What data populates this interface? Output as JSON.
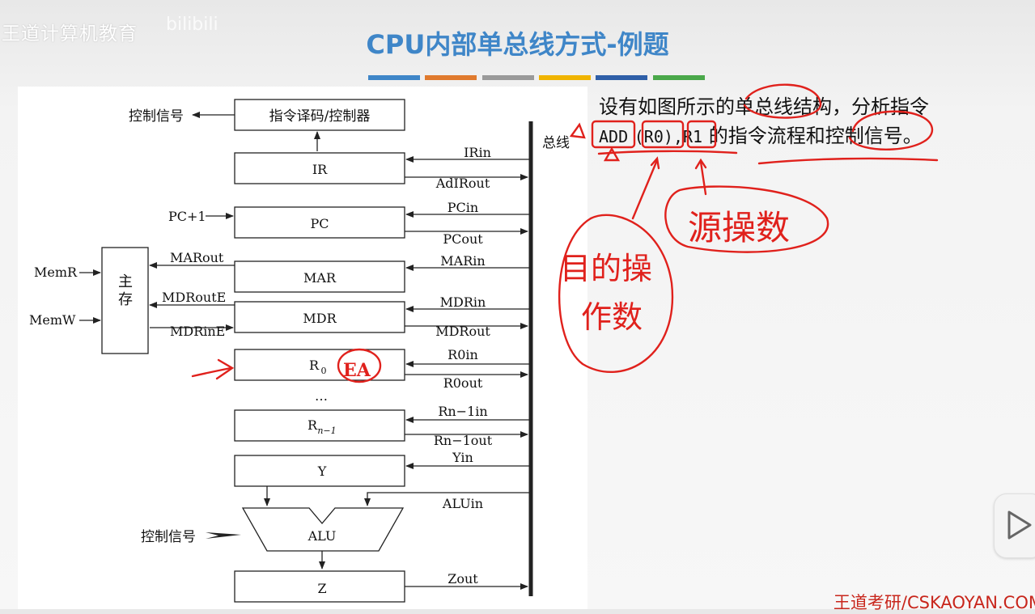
{
  "brand": {
    "text": "王道计算机教育",
    "mark": "bilibili"
  },
  "title": "CPU内部单总线方式-例题",
  "accent_bars": [
    "#3f86c8",
    "#e07a2e",
    "#9a9a9a",
    "#f0b400",
    "#2f5fa8",
    "#4aa84a"
  ],
  "question": {
    "line1": "设有如图所示的单总线结构，分析指令",
    "instr_op": "ADD",
    "instr_src": "(R0)",
    "instr_sep": ",",
    "instr_dst": "R1",
    "line2_tail": "的指令流程和控制信号。"
  },
  "annotations": {
    "dest_operand": [
      "目的操",
      "作数"
    ],
    "src_operand": "源操数",
    "ea": "EA"
  },
  "diagram": {
    "bus_label": "总线",
    "blocks": {
      "decoder": "指令译码/控制器",
      "ir": "IR",
      "pc": "PC",
      "mar": "MAR",
      "mdr": "MDR",
      "r0": "R",
      "r0_sub": "0",
      "rn": "R",
      "rn_sub": "n−1",
      "y": "Y",
      "alu": "ALU",
      "z": "Z",
      "memory_top": "主",
      "memory_bottom": "存"
    },
    "signals": {
      "ctrl_out": "控制信号",
      "ctrl_in": "控制信号",
      "irin": "IRin",
      "adirout": "AdIRout",
      "pc_inc": "PC+1",
      "pcin": "PCin",
      "pcout": "PCout",
      "marout": "MARout",
      "marin": "MARin",
      "memr": "MemR",
      "memw": "MemW",
      "mdroute": "MDRoutE",
      "mdrine": "MDRinE",
      "mdrin": "MDRin",
      "mdrout": "MDRout",
      "r0in": "R0in",
      "r0out": "R0out",
      "ellipsis": "…",
      "rnin": "Rn−1in",
      "rnout": "Rn−1out",
      "yin": "Yin",
      "aluin": "ALUin",
      "zout": "Zout"
    }
  },
  "footer": "王道考研/CSKAOYAN.COM"
}
